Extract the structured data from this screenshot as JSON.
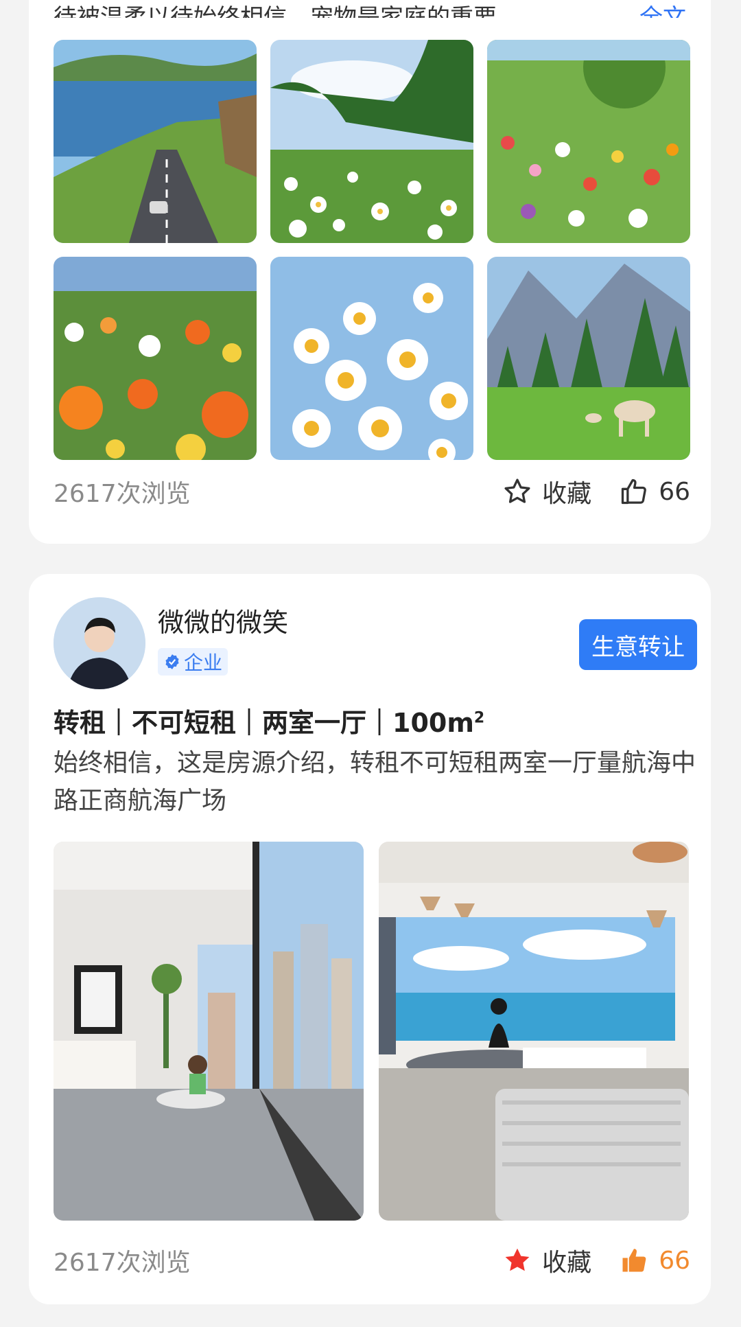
{
  "card1": {
    "truncated_text": "待被温柔以待始终相信，宠物是家庭的重要...",
    "more_label": "全文",
    "views": "2617次浏览",
    "favorite_label": "收藏",
    "like_count": "66",
    "images": [
      "coastal-road",
      "daisy-meadow",
      "wildflower-garden",
      "poppy-field",
      "daisy-closeup",
      "mountain-horse"
    ]
  },
  "card2": {
    "username": "微微的微笑",
    "badge_label": "企业",
    "action_button_label": "生意转让",
    "post_title": "转租｜不可短租｜两室一厅｜100m",
    "post_title_sup": "2",
    "post_description": "始终相信，这是房源介绍，转租不可短租两室一厅量航海中路正商航海广场",
    "views": "2617次浏览",
    "favorite_label": "收藏",
    "like_count": "66",
    "favorite_active": true,
    "like_active": true,
    "images": [
      "living-room-window",
      "bedroom-sea-view"
    ]
  },
  "colors": {
    "accent_blue": "#2f7cf6",
    "star_active": "#f0342c",
    "like_active": "#f28a2e"
  }
}
